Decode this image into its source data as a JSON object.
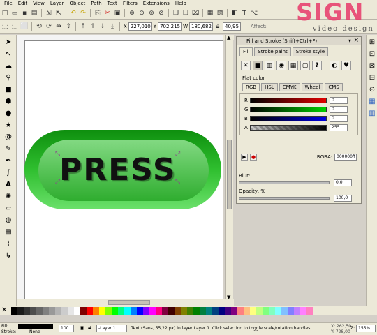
{
  "menu": [
    "File",
    "Edit",
    "View",
    "Layer",
    "Object",
    "Path",
    "Text",
    "Filters",
    "Extensions",
    "Help"
  ],
  "toolbar2": {
    "x_label": "X",
    "x_value": "227,010",
    "y_label": "Y",
    "y_value": "702,215",
    "w_label": "W",
    "w_value": "180,682",
    "h_value": "40,95",
    "affect_label": "Affect:"
  },
  "watermark": {
    "brand": "SIGN",
    "sub": "video design"
  },
  "canvas": {
    "button_text": "PRESS",
    "button_color": "#22a822"
  },
  "dialog": {
    "title": "Fill and Stroke (Shift+Ctrl+F)",
    "tabs": [
      "Fill",
      "Stroke paint",
      "Stroke style"
    ],
    "flat_color_label": "Flat color",
    "mode_tabs": [
      "RGB",
      "HSL",
      "CMYK",
      "Wheel",
      "CMS"
    ],
    "channels": [
      {
        "label": "R",
        "value": "0",
        "color": "#e00000"
      },
      {
        "label": "G",
        "value": "0",
        "color": "#00d000"
      },
      {
        "label": "B",
        "value": "0",
        "color": "#0000e0"
      },
      {
        "label": "A",
        "value": "255",
        "color": "#000000"
      }
    ],
    "rgba_label": "RGBA:",
    "rgba_value": "000000ff"
  },
  "blur": {
    "label": "Blur:",
    "value": "0,0"
  },
  "opacity": {
    "label": "Opacity, %",
    "value": "100,0"
  },
  "status": {
    "fill_label": "Fill:",
    "stroke_label": "Stroke:",
    "stroke_value": "None",
    "opacity_value": "100",
    "layer_value": "-Layer 1",
    "message": "Text (Sans, 55,22 px) in layer Layer 1. Click selection to toggle scale/rotation handles.",
    "x_coord": "X: 262,50",
    "y_coord": "Y: 728,00",
    "zoom_label": "Z:",
    "zoom_value": "155%"
  },
  "palette_colors": [
    "#000000",
    "#1a1a1a",
    "#333333",
    "#4d4d4d",
    "#666666",
    "#808080",
    "#999999",
    "#b3b3b3",
    "#cccccc",
    "#e6e6e6",
    "#ffffff",
    "#800000",
    "#ff0000",
    "#ff8000",
    "#ffff00",
    "#80ff00",
    "#00ff00",
    "#00ff80",
    "#00ffff",
    "#0080ff",
    "#0000ff",
    "#8000ff",
    "#ff00ff",
    "#ff0080",
    "#800040",
    "#400000",
    "#804000",
    "#808000",
    "#408000",
    "#008000",
    "#008040",
    "#008080",
    "#004080",
    "#000080",
    "#400080",
    "#800080",
    "#ff8080",
    "#ffc080",
    "#ffff80",
    "#c0ff80",
    "#80ff80",
    "#80ffc0",
    "#80ffff",
    "#80c0ff",
    "#8080ff",
    "#c080ff",
    "#ff80ff",
    "#ff80c0"
  ],
  "left_tools": [
    "select-icon",
    "node-icon",
    "tweak-icon",
    "zoom-icon",
    "rect-icon",
    "box3d-icon",
    "ellipse-icon",
    "star-icon",
    "spiral-icon",
    "pencil-icon",
    "pen-icon",
    "callig-icon",
    "text-icon",
    "spray-icon",
    "eraser-icon",
    "bucket-icon",
    "gradient-icon",
    "dropper-icon",
    "connector-icon"
  ]
}
